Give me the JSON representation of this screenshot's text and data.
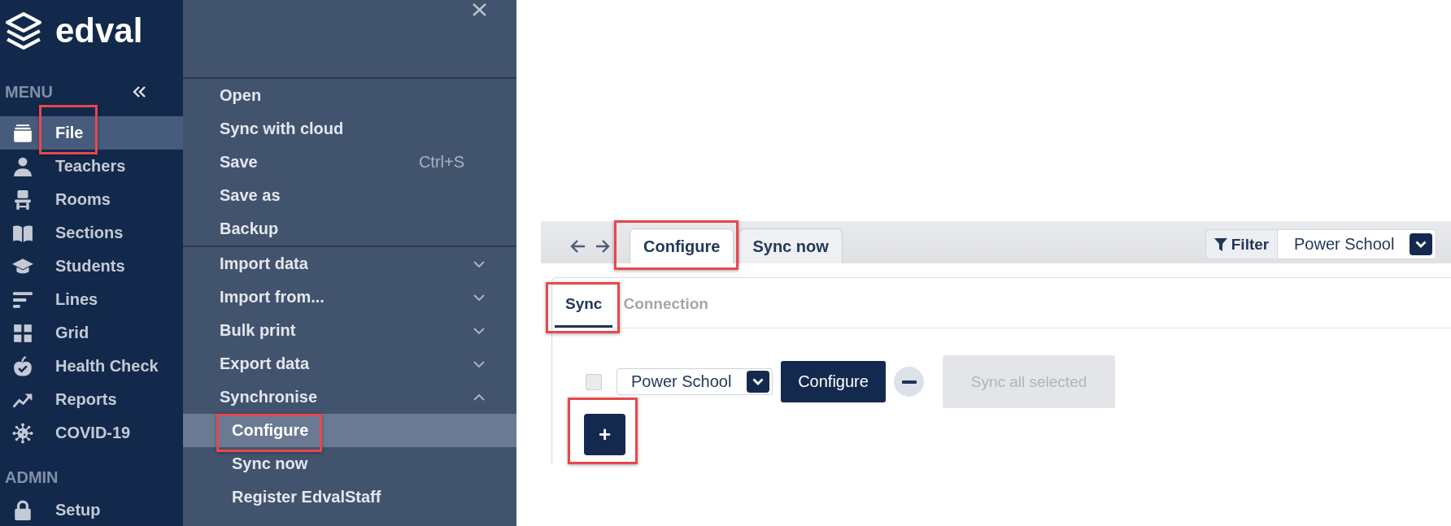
{
  "sidebar": {
    "logo": "edval",
    "sections": [
      {
        "label": "MENU",
        "collapsible": true,
        "items": [
          {
            "label": "File",
            "selected": true,
            "outlined": true
          },
          {
            "label": "Teachers",
            "selected": false,
            "outlined": false
          },
          {
            "label": "Rooms",
            "selected": false,
            "outlined": false
          },
          {
            "label": "Sections",
            "selected": false,
            "outlined": false
          },
          {
            "label": "Students",
            "selected": false,
            "outlined": false
          },
          {
            "label": "Lines",
            "selected": false,
            "outlined": false
          },
          {
            "label": "Grid",
            "selected": false,
            "outlined": false
          },
          {
            "label": "Health Check",
            "selected": false,
            "outlined": false
          },
          {
            "label": "Reports",
            "selected": false,
            "outlined": false
          },
          {
            "label": "COVID-19",
            "selected": false,
            "outlined": false
          }
        ]
      },
      {
        "label": "ADMIN",
        "collapsible": false,
        "items": [
          {
            "label": "Setup",
            "selected": false,
            "outlined": false
          }
        ]
      }
    ]
  },
  "file_menu": {
    "groups": [
      {
        "items": [
          {
            "kind": "action",
            "label": "Open",
            "selected": false,
            "outlined": false
          },
          {
            "kind": "action",
            "label": "Sync with cloud",
            "selected": false,
            "outlined": false
          },
          {
            "kind": "action",
            "label": "Save",
            "shortcut": "Ctrl+S",
            "selected": false,
            "outlined": false
          },
          {
            "kind": "action",
            "label": "Save as",
            "selected": false,
            "outlined": false
          },
          {
            "kind": "action",
            "label": "Backup",
            "selected": false,
            "outlined": false
          }
        ]
      },
      {
        "items": [
          {
            "kind": "submenu",
            "label": "Import data",
            "expanded": false
          },
          {
            "kind": "submenu",
            "label": "Import from...",
            "expanded": false
          },
          {
            "kind": "submenu",
            "label": "Bulk print",
            "expanded": false
          },
          {
            "kind": "submenu",
            "label": "Export data",
            "expanded": false
          },
          {
            "kind": "submenu",
            "label": "Synchronise",
            "expanded": true,
            "children": [
              {
                "kind": "action",
                "label": "Configure",
                "selected": true,
                "outlined": true
              },
              {
                "kind": "action",
                "label": "Sync now",
                "selected": false,
                "outlined": false
              },
              {
                "kind": "action",
                "label": "Register EdvalStaff",
                "selected": false,
                "outlined": false
              }
            ]
          }
        ]
      }
    ]
  },
  "sync_page": {
    "tabs": [
      {
        "label": "Configure",
        "selected": true,
        "outlined": true
      },
      {
        "label": "Sync now",
        "selected": false,
        "outlined": false
      }
    ],
    "filter": {
      "label": "Filter",
      "value": "Power School"
    },
    "subtabs": [
      {
        "label": "Sync",
        "selected": true,
        "outlined": true
      },
      {
        "label": "Connection",
        "selected": false,
        "outlined": false
      }
    ],
    "connections": [
      {
        "checked": false,
        "source": "Power School",
        "action": "Configure"
      }
    ],
    "sync_all": {
      "label": "Sync all selected",
      "disabled": true
    },
    "add": {
      "label": "+",
      "outlined": true
    }
  }
}
